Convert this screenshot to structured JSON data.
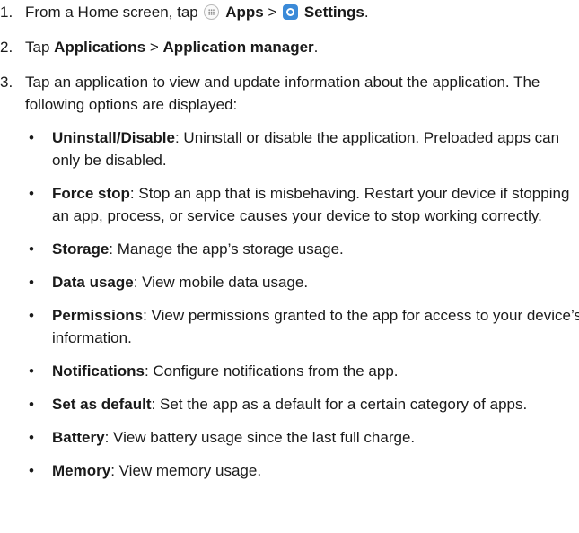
{
  "steps": [
    {
      "num": "1.",
      "pre": "From a Home screen, tap ",
      "apps_label": "Apps",
      "sep": " > ",
      "settings_label": "Settings",
      "post": "."
    },
    {
      "num": "2.",
      "pre": "Tap ",
      "applications_label": "Applications",
      "sep": " > ",
      "app_manager_label": "Application manager",
      "post": "."
    },
    {
      "num": "3.",
      "text": "Tap an application to view and update information about the application. The following options are displayed:"
    }
  ],
  "options": [
    {
      "term": "Uninstall/Disable",
      "desc": ": Uninstall or disable the application. Preloaded apps can only be disabled."
    },
    {
      "term": "Force stop",
      "desc": ": Stop an app that is misbehaving. Restart your device if stopping an app, process, or service causes your device to stop working correctly."
    },
    {
      "term": "Storage",
      "desc": ": Manage the app’s storage usage."
    },
    {
      "term": "Data usage",
      "desc": ": View mobile data usage."
    },
    {
      "term": "Permissions",
      "desc": ": View permissions granted to the app for access to your device’s information."
    },
    {
      "term": "Notifications",
      "desc": ": Configure notifications from the app."
    },
    {
      "term": "Set as default",
      "desc": ": Set the app as a default for a certain category of apps."
    },
    {
      "term": "Battery",
      "desc": ": View battery usage since the last full charge."
    },
    {
      "term": "Memory",
      "desc": ": View memory usage."
    }
  ],
  "bullet": "•",
  "icons": {
    "apps": "apps-icon",
    "settings": "settings-icon"
  },
  "colors": {
    "settings_icon": "#3b8ad8",
    "text": "#1a1a1a"
  }
}
